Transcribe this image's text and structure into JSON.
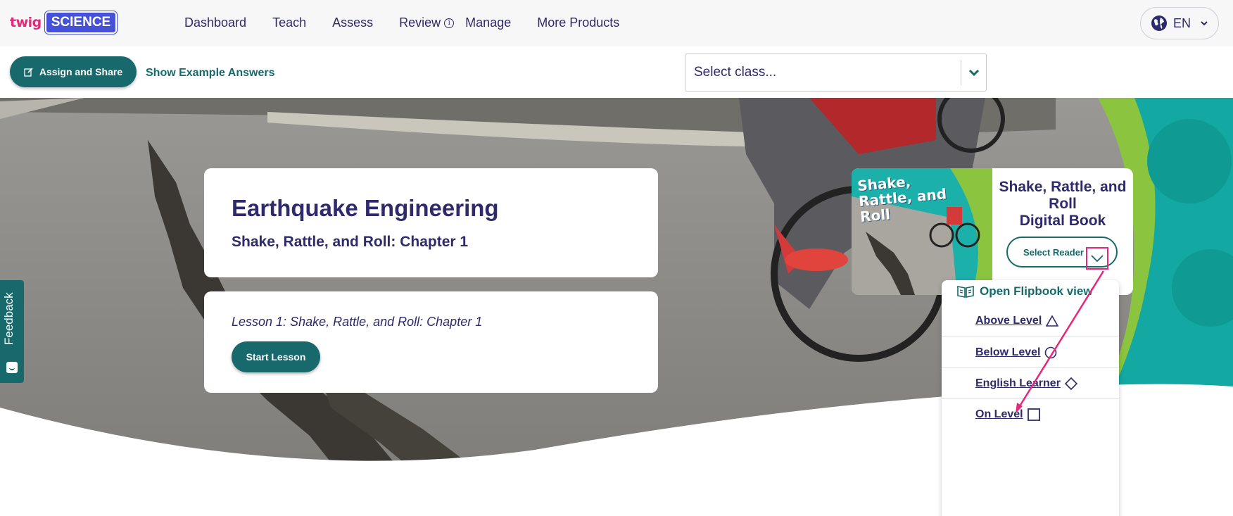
{
  "header": {
    "logo_twig": "twig",
    "logo_science": "SCIENCE",
    "nav": [
      "Dashboard",
      "Teach",
      "Assess",
      "Review",
      "Manage",
      "More Products"
    ],
    "review_info_icon": "i",
    "language": "EN"
  },
  "toolbar": {
    "assign_label": "Assign and Share",
    "show_answers_label": "Show Example Answers",
    "class_select_placeholder": "Select class..."
  },
  "lesson": {
    "title": "Earthquake Engineering",
    "subtitle": "Shake, Rattle, and Roll: Chapter 1",
    "lesson_title": "Lesson 1: Shake, Rattle, and Roll: Chapter 1",
    "start_label": "Start Lesson"
  },
  "feedback": {
    "label": "Feedback"
  },
  "book": {
    "cover_title": "Shake, Rattle, and Roll",
    "title_line1": "Shake, Rattle, and",
    "title_line2": "Roll",
    "title_line3": "Digital Book",
    "select_reader_label": "Select Reader"
  },
  "reader_menu": {
    "open_flipbook": "Open Flipbook view",
    "items": [
      {
        "label": "Above Level",
        "shape": "triangle-icon"
      },
      {
        "label": "Below Level",
        "shape": "circle-icon"
      },
      {
        "label": "English Learner",
        "shape": "diamond-icon"
      },
      {
        "label": "On Level",
        "shape": "square-icon"
      }
    ]
  },
  "colors": {
    "teal": "#17696b",
    "navy": "#2e2a6b",
    "pink": "#e6277a",
    "science_blue": "#4451d8"
  }
}
